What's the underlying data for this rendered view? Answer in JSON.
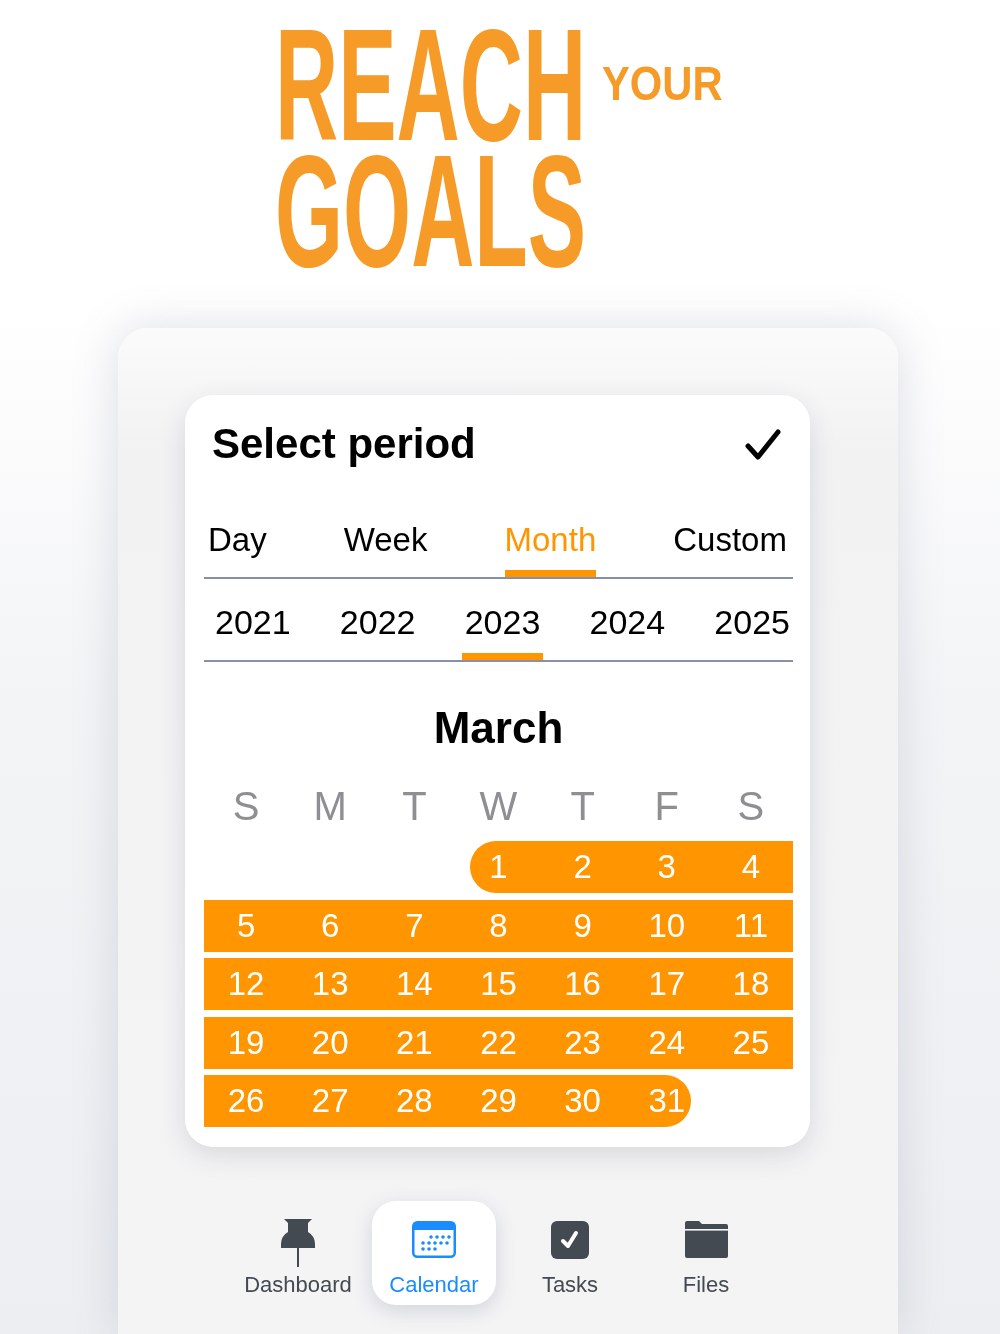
{
  "headline": {
    "line_1": "REACH",
    "aside": "YOUR",
    "line_2": "GOALS"
  },
  "period_dialog": {
    "title": "Select period",
    "period_tabs": [
      {
        "label": "Day",
        "selected": false
      },
      {
        "label": "Week",
        "selected": false
      },
      {
        "label": "Month",
        "selected": true
      },
      {
        "label": "Custom",
        "selected": false
      }
    ],
    "year_tabs": [
      {
        "label": "2021",
        "selected": false
      },
      {
        "label": "2022",
        "selected": false
      },
      {
        "label": "2023",
        "selected": true
      },
      {
        "label": "2024",
        "selected": false
      },
      {
        "label": "2025",
        "selected": false
      }
    ],
    "calendar": {
      "month": "March",
      "weekdays": [
        "S",
        "M",
        "T",
        "W",
        "T",
        "F",
        "S"
      ],
      "weeks": [
        [
          {
            "day": "1",
            "selected": true
          },
          {
            "day": "2",
            "selected": true
          },
          {
            "day": "3",
            "selected": true
          },
          {
            "day": "4",
            "selected": true
          }
        ],
        [
          {
            "day": "5",
            "selected": true
          },
          {
            "day": "6",
            "selected": true
          },
          {
            "day": "7",
            "selected": true
          },
          {
            "day": "8",
            "selected": true
          },
          {
            "day": "9",
            "selected": true
          },
          {
            "day": "10",
            "selected": true
          },
          {
            "day": "11",
            "selected": true
          }
        ],
        [
          {
            "day": "12",
            "selected": true
          },
          {
            "day": "13",
            "selected": true
          },
          {
            "day": "14",
            "selected": true
          },
          {
            "day": "15",
            "selected": true
          },
          {
            "day": "16",
            "selected": true
          },
          {
            "day": "17",
            "selected": true
          },
          {
            "day": "18",
            "selected": true
          }
        ],
        [
          {
            "day": "19",
            "selected": true
          },
          {
            "day": "20",
            "selected": true
          },
          {
            "day": "21",
            "selected": true
          },
          {
            "day": "22",
            "selected": true
          },
          {
            "day": "23",
            "selected": true
          },
          {
            "day": "24",
            "selected": true
          },
          {
            "day": "25",
            "selected": true
          }
        ],
        [
          {
            "day": "26",
            "selected": true
          },
          {
            "day": "27",
            "selected": true
          },
          {
            "day": "28",
            "selected": true
          },
          {
            "day": "29",
            "selected": true
          },
          {
            "day": "30",
            "selected": true
          },
          {
            "day": "31",
            "selected": true
          }
        ]
      ]
    }
  },
  "tab_bar": {
    "items": [
      {
        "label": "Dashboard",
        "kind": "dashboard",
        "selected": false
      },
      {
        "label": "Calendar",
        "kind": "calendar",
        "selected": true
      },
      {
        "label": "Tasks",
        "kind": "tasks",
        "selected": false
      },
      {
        "label": "Files",
        "kind": "files",
        "selected": false
      }
    ]
  }
}
